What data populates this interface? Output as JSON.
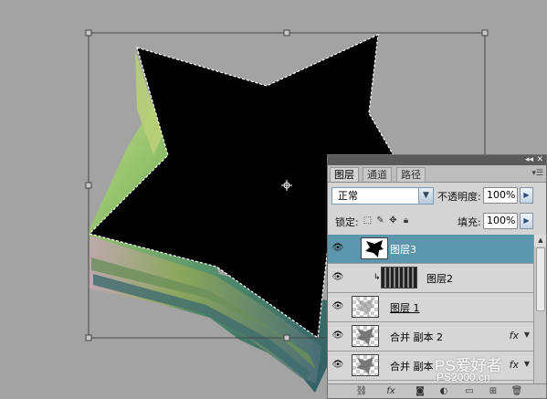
{
  "colors": {
    "canvas_bg": "#a3a3a3",
    "star_fill": "#000000",
    "selected_layer": "#5c96ad",
    "panel_bg": "#d4d4d4"
  },
  "panel": {
    "collapse_glyph": "◂◂",
    "close_glyph": "✕",
    "menu_icon": "panel-menu-icon",
    "tabs": [
      {
        "label": "图层",
        "active": true
      },
      {
        "label": "通道",
        "active": false
      },
      {
        "label": "路径",
        "active": false
      }
    ],
    "blend_mode": "正常",
    "opacity_label": "不透明度:",
    "opacity_value": "100%",
    "lock_label": "锁定:",
    "fill_label": "填充:",
    "fill_value": "100%",
    "lock_icons": [
      "lock-transparent-icon",
      "lock-brush-icon",
      "lock-move-icon",
      "lock-all-icon"
    ]
  },
  "layers": [
    {
      "name": "图层3",
      "selected": true,
      "thumbnail": "star-black",
      "fx": false
    },
    {
      "name": "图层2",
      "selected": false,
      "thumbnail": "stripes",
      "fx": false,
      "clipped": true
    },
    {
      "name": "图层 1",
      "selected": false,
      "thumbnail": "checker-star",
      "fx": false
    },
    {
      "name": "合并 副本 2",
      "selected": false,
      "thumbnail": "checker-star",
      "fx": true
    },
    {
      "name": "合并 副本",
      "selected": false,
      "thumbnail": "checker-star",
      "fx": true
    }
  ],
  "fx_label": "fx",
  "bottom_icons": [
    "link-icon",
    "fx-icon",
    "mask-icon",
    "adjustment-icon",
    "group-icon",
    "new-layer-icon",
    "trash-icon"
  ],
  "watermark": {
    "text": "PS爱好者",
    "sub": "PS2000.cn"
  }
}
